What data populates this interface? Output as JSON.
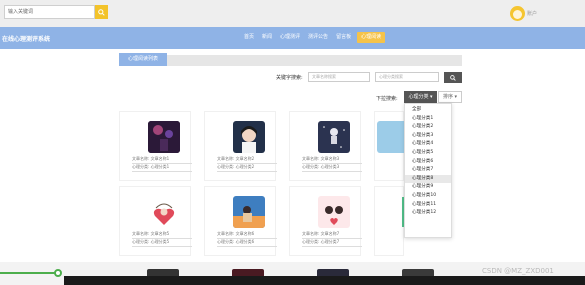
{
  "topbar": {
    "search_placeholder": "输入关键词",
    "user_label": "账户"
  },
  "header": {
    "site_title": "在线心理测评系统",
    "nav": [
      "首页",
      "新闻",
      "心理测评",
      "测评公告",
      "留言板",
      "心理阅读"
    ]
  },
  "section": {
    "title": "心理阅读列表",
    "keyword_label": "关键字搜索:",
    "keyword_placeholder": "文章名称搜索",
    "category_placeholder": "心理分类搜索",
    "sort_label": "下拉搜索:",
    "category_select": "心理分类",
    "order_select": "排序"
  },
  "dropdown": {
    "items": [
      "全部",
      "心理分类1",
      "心理分类2",
      "心理分类3",
      "心理分类4",
      "心理分类5",
      "心理分类6",
      "心理分类7",
      "心理分类8",
      "心理分类9",
      "心理分类10",
      "心理分类11",
      "心理分类12"
    ],
    "hover_index": 8
  },
  "cards": [
    {
      "name": "文章名称: 文章名称1",
      "category": "心理分类: 心理分类1",
      "img": "purple-lights"
    },
    {
      "name": "文章名称: 文章名称2",
      "category": "心理分类: 心理分类2",
      "img": "girl-dark"
    },
    {
      "name": "文章名称: 文章名称3",
      "category": "心理分类: 心理分类3",
      "img": "astronaut"
    },
    {
      "name": "文章名称: 文章名称5",
      "category": "心理分类: 心理分类5",
      "img": "girl-heart"
    },
    {
      "name": "文章名称: 文章名称6",
      "category": "心理分类: 心理分类6",
      "img": "boy-window"
    },
    {
      "name": "文章名称: 文章名称7",
      "category": "心理分类: 心理分类7",
      "img": "couple-pink"
    }
  ],
  "watermark": "CSDN @MZ_ZXD001"
}
